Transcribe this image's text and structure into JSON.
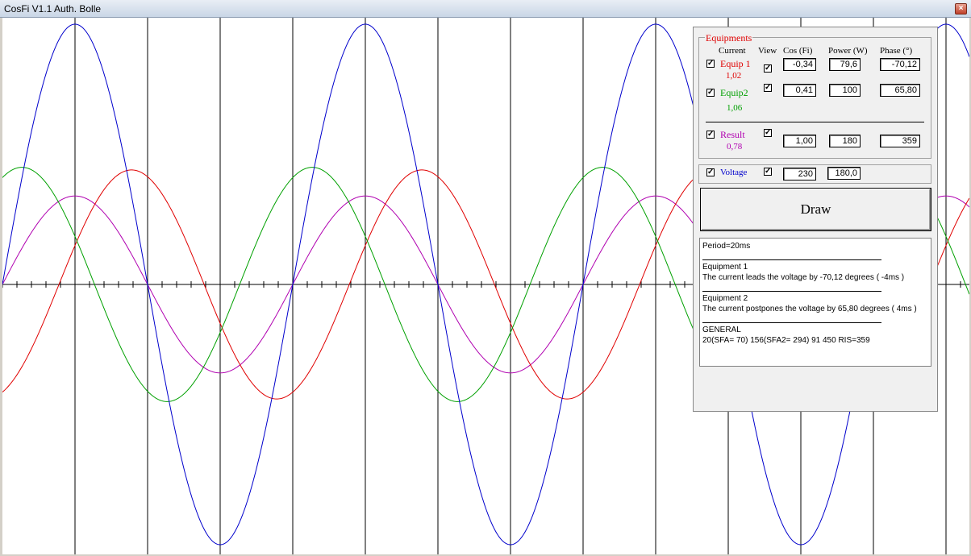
{
  "window": {
    "title": "CosFi V1.1 Auth. Bolle",
    "close_glyph": "×"
  },
  "colors": {
    "voltage": "#0000cc",
    "equip1": "#e00000",
    "equip2": "#00a000",
    "result": "#b000b0",
    "axis": "#000000"
  },
  "chart_data": {
    "type": "line",
    "title": "",
    "xlabel": "",
    "ylabel": "",
    "period_ms": 20,
    "x_range_ms": [
      0,
      66.5
    ],
    "grid": "vertical lines every 5 ms",
    "series": [
      {
        "name": "Voltage",
        "amplitude": 1.0,
        "phase_deg": 0,
        "color": "#0000cc"
      },
      {
        "name": "Equip 1",
        "amplitude": 0.44,
        "phase_deg": -70.12,
        "color": "#e00000"
      },
      {
        "name": "Equip2",
        "amplitude": 0.45,
        "phase_deg": 65.8,
        "color": "#00a000"
      },
      {
        "name": "Result",
        "amplitude": 0.34,
        "phase_deg": 0,
        "color": "#b000b0"
      }
    ]
  },
  "panel": {
    "group_title": "Equipments",
    "headers": {
      "current": "Current",
      "view": "View",
      "cos": "Cos (Fi)",
      "power": "Power (W)",
      "phase": "Phase (°)"
    },
    "check_glyph": "✓",
    "equip1": {
      "label": "Equip 1",
      "current": "1,02",
      "cos": "-0,34",
      "power": "79,6",
      "phase": "-70,12"
    },
    "equip2": {
      "label": "Equip2",
      "current": "1,06",
      "cos": "0,41",
      "power": "100",
      "phase": "65,80"
    },
    "result": {
      "label": "Result",
      "current": "0,78",
      "cos": "1,00",
      "power": "180",
      "phase": "359"
    },
    "voltage": {
      "label": "Voltage",
      "value": "230",
      "phase": "180,0"
    },
    "draw_label": "Draw"
  },
  "info": {
    "period": "Period=20ms",
    "eq1_title": "Equipment 1",
    "eq1_text": "The current leads the voltage by -70,12 degrees ( -4ms )",
    "eq2_title": "Equipment 2",
    "eq2_text": "The current postpones the voltage by 65,80 degrees ( 4ms )",
    "general_title": "GENERAL",
    "general_text": "20(SFA= 70) 156(SFA2= 294)  91 450 RIS=359"
  }
}
